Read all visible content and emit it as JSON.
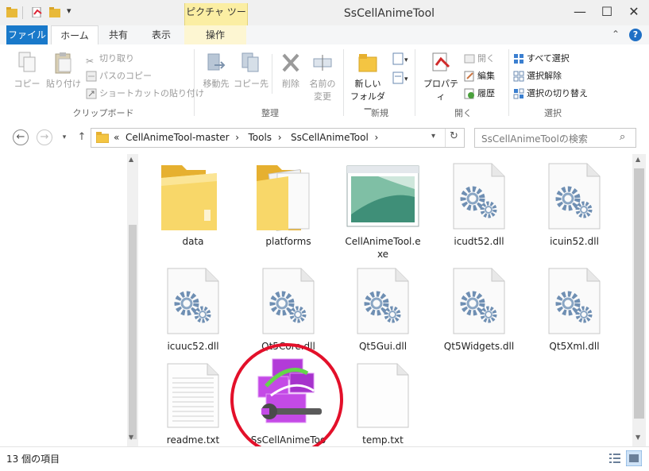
{
  "window": {
    "title": "SsCellAnimeTool",
    "contextual_tab_group": "ピクチャ ツール",
    "minimize": "—",
    "maximize": "☐",
    "close": "✕"
  },
  "tabs": [
    {
      "label": "ファイル"
    },
    {
      "label": "ホーム"
    },
    {
      "label": "共有"
    },
    {
      "label": "表示"
    },
    {
      "label": "操作"
    }
  ],
  "ribbon": {
    "clipboard": {
      "group": "クリップボード",
      "copy": "コピー",
      "paste": "貼り付け",
      "cut": "切り取り",
      "copy_path": "パスのコピー",
      "paste_shortcut": "ショートカットの貼り付け"
    },
    "organize": {
      "group": "整理",
      "move_to": "移動先",
      "copy_to": "コピー先",
      "delete": "削除",
      "rename_1": "名前の",
      "rename_2": "変更"
    },
    "new": {
      "group": "新規",
      "new_folder_1": "新しい",
      "new_folder_2": "フォルダー"
    },
    "open": {
      "group": "開く",
      "properties": "プロパティ",
      "open": "開く",
      "edit": "編集",
      "history": "履歴"
    },
    "select": {
      "group": "選択",
      "select_all": "すべて選択",
      "select_none": "選択解除",
      "invert": "選択の切り替え"
    }
  },
  "address": {
    "breadcrumbs": [
      "«",
      "CellAnimeTool-master",
      "›",
      "Tools",
      "›",
      "SsCellAnimeTool",
      "›"
    ],
    "search_placeholder": "SsCellAnimeToolの検索"
  },
  "files": [
    {
      "name": "data",
      "icon": "folder-icon"
    },
    {
      "name": "platforms",
      "icon": "folder-open-icon"
    },
    {
      "name": "CellAnimeTool.e",
      "name2": "xe",
      "icon": "exe-icon"
    },
    {
      "name": "icudt52.dll",
      "icon": "dll-icon"
    },
    {
      "name": "icuin52.dll",
      "icon": "dll-icon"
    },
    {
      "name": "icuuc52.dll",
      "icon": "dll-icon"
    },
    {
      "name": "Qt5Core.dll",
      "icon": "dll-icon"
    },
    {
      "name": "Qt5Gui.dll",
      "icon": "dll-icon"
    },
    {
      "name": "Qt5Widgets.dll",
      "icon": "dll-icon"
    },
    {
      "name": "Qt5Xml.dll",
      "icon": "dll-icon"
    },
    {
      "name": "readme.txt",
      "icon": "text-file-icon"
    },
    {
      "name": "SsCellAnimeToo",
      "icon": "app-icon"
    },
    {
      "name": "temp.txt",
      "icon": "text-file-icon"
    }
  ],
  "status": {
    "count": "13 個の項目"
  },
  "colors": {
    "file_tab": "#1979ca",
    "contextual_tab": "#fbeea3",
    "highlight_circle": "#e3102a",
    "folder": "#f4c542"
  }
}
